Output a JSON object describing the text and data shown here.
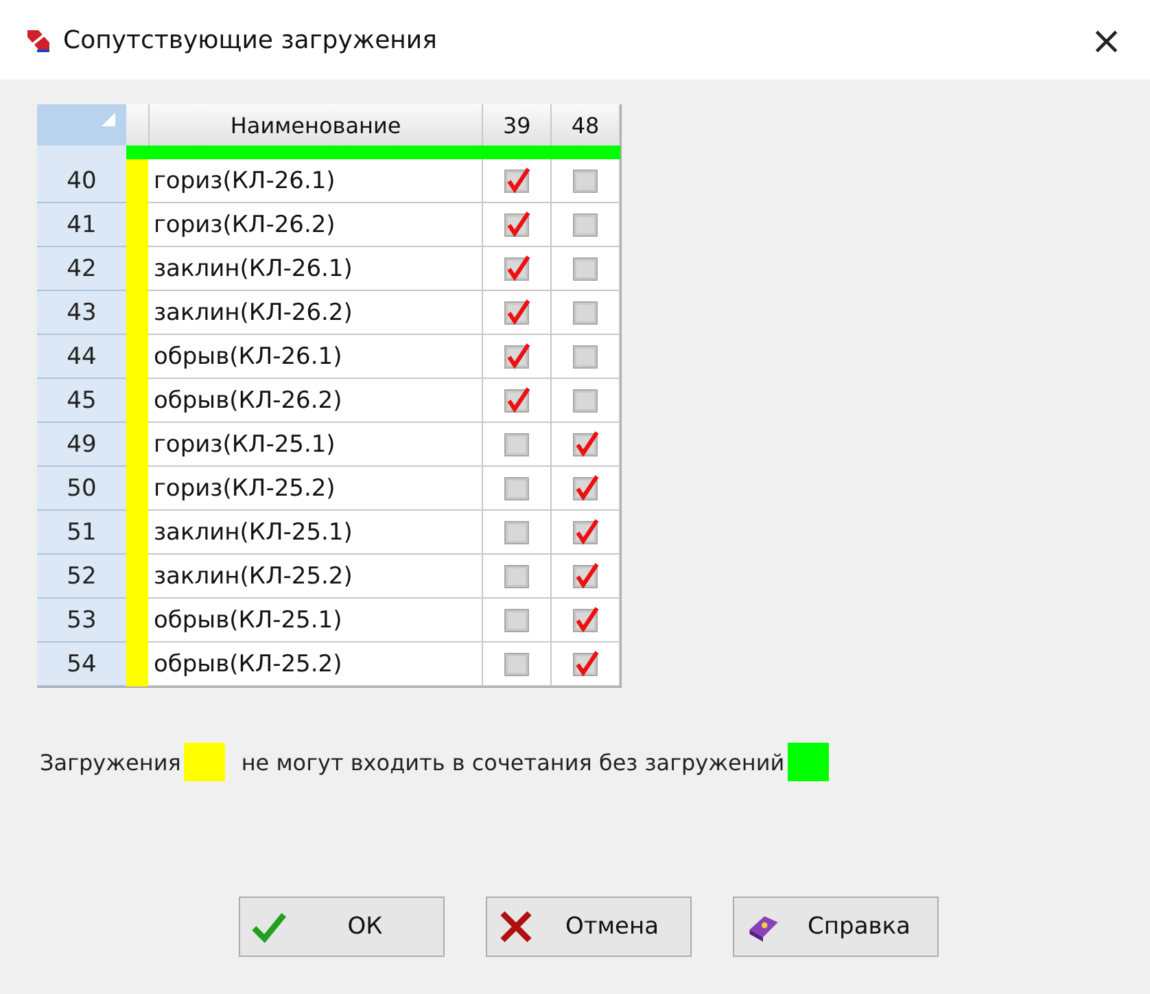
{
  "window": {
    "title": "Сопутствующие загружения",
    "close": "×"
  },
  "table": {
    "columns": [
      "Наименование",
      "39",
      "48"
    ],
    "rows": [
      {
        "number": "40",
        "name": "гориз(КЛ-26.1)",
        "color": "#ffff00",
        "checks": [
          true,
          false
        ]
      },
      {
        "number": "41",
        "name": "гориз(КЛ-26.2)",
        "color": "#ffff00",
        "checks": [
          true,
          false
        ]
      },
      {
        "number": "42",
        "name": "заклин(КЛ-26.1)",
        "color": "#ffff00",
        "checks": [
          true,
          false
        ]
      },
      {
        "number": "43",
        "name": "заклин(КЛ-26.2)",
        "color": "#ffff00",
        "checks": [
          true,
          false
        ]
      },
      {
        "number": "44",
        "name": "обрыв(КЛ-26.1)",
        "color": "#ffff00",
        "checks": [
          true,
          false
        ]
      },
      {
        "number": "45",
        "name": "обрыв(КЛ-26.2)",
        "color": "#ffff00",
        "checks": [
          true,
          false
        ]
      },
      {
        "number": "49",
        "name": "гориз(КЛ-25.1)",
        "color": "#ffff00",
        "checks": [
          false,
          true
        ]
      },
      {
        "number": "50",
        "name": "гориз(КЛ-25.2)",
        "color": "#ffff00",
        "checks": [
          false,
          true
        ]
      },
      {
        "number": "51",
        "name": "заклин(КЛ-25.1)",
        "color": "#ffff00",
        "checks": [
          false,
          true
        ]
      },
      {
        "number": "52",
        "name": "заклин(КЛ-25.2)",
        "color": "#ffff00",
        "checks": [
          false,
          true
        ]
      },
      {
        "number": "53",
        "name": "обрыв(КЛ-25.1)",
        "color": "#ffff00",
        "checks": [
          false,
          true
        ]
      },
      {
        "number": "54",
        "name": "обрыв(КЛ-25.2)",
        "color": "#ffff00",
        "checks": [
          false,
          true
        ]
      }
    ]
  },
  "legend": [
    {
      "text": "Загружения",
      "color": "#ffff00"
    },
    {
      "text": "не могут входить в сочетания без загружений",
      "color": "#00ff00"
    }
  ],
  "buttons": [
    {
      "kind": "ok",
      "label": "ОК"
    },
    {
      "kind": "cancel",
      "label": "Отмена"
    },
    {
      "kind": "help",
      "label": "Справка"
    }
  ]
}
